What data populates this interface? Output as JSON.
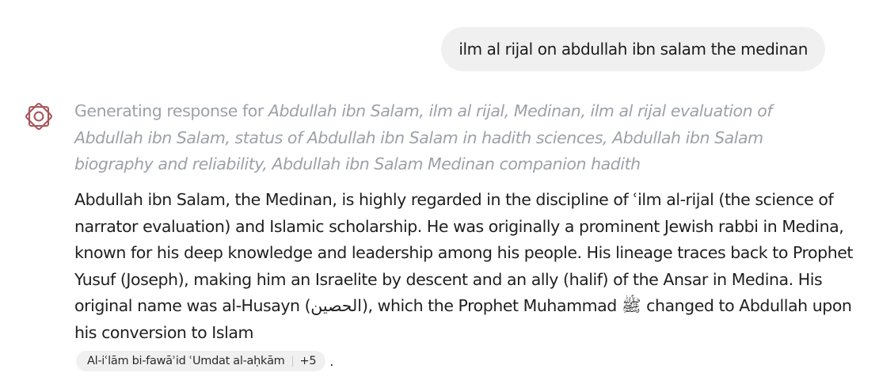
{
  "user_message": {
    "text": "ilm al rijal on abdullah ibn salam the medinan"
  },
  "status": {
    "prefix": "Generating response for ",
    "queries": "Abdullah ibn Salam, ilm al rijal, Medinan, ilm al rijal evaluation of Abdullah ibn Salam, status of Abdullah ibn Salam in hadith sciences, Abdullah ibn Salam biography and reliability, Abdullah ibn Salam Medinan companion hadith"
  },
  "answer": {
    "text": "Abdullah ibn Salam, the Medinan, is highly regarded in the discipline of ʿilm al-rijal (the science of narrator evaluation) and Islamic scholarship. He was originally a prominent Jewish rabbi in Medina, known for his deep knowledge and leadership among his people. His lineage traces back to Prophet Yusuf (Joseph), making him an Israelite by descent and an ally (halif) of the Ansar in Medina. His original name was al-Husayn (الحصين), which the Prophet Muhammad ﷺ changed to Abdullah upon his conversion to Islam"
  },
  "citation": {
    "source": "Al-iʿlām bi-fawāʾid ʿUmdat al-aḥkām",
    "more": "+5",
    "trailing": "."
  },
  "icons": {
    "assistant": "rosette-logo-icon"
  },
  "colors": {
    "logo": "#a7585c",
    "status_text": "#9da1a8",
    "bubble_bg": "#f0f0f1"
  }
}
